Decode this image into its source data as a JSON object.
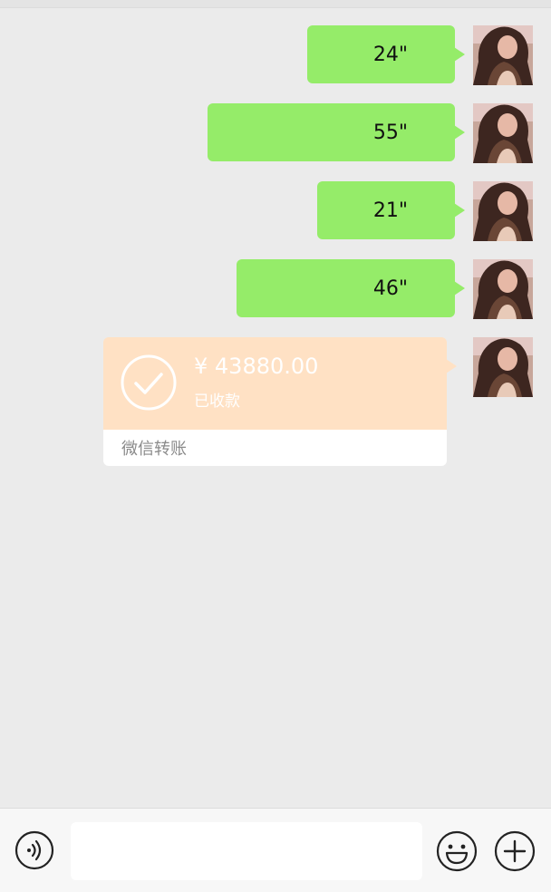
{
  "colors": {
    "chat_background": "#ebebeb",
    "sent_bubble": "#95ec69",
    "transfer_card": "#ffe1c4",
    "transfer_footer": "#ffffff",
    "input_bar": "#f7f7f7"
  },
  "messages": [
    {
      "type": "voice",
      "text": "24\"",
      "avatar_icon": "user-avatar-photo"
    },
    {
      "type": "voice",
      "text": "55\"",
      "avatar_icon": "user-avatar-photo"
    },
    {
      "type": "voice",
      "text": "21\"",
      "avatar_icon": "user-avatar-photo"
    },
    {
      "type": "voice",
      "text": "46\"",
      "avatar_icon": "user-avatar-photo"
    }
  ],
  "transfer": {
    "amount": "¥ 43880.00",
    "status": "已收款",
    "footer": "微信转账",
    "icon": "check-circle-icon",
    "avatar_icon": "user-avatar-photo"
  },
  "input_bar": {
    "voice_icon": "voice-input-icon",
    "text_value": "",
    "emoji_icon": "emoji-icon",
    "plus_icon": "plus-icon"
  }
}
